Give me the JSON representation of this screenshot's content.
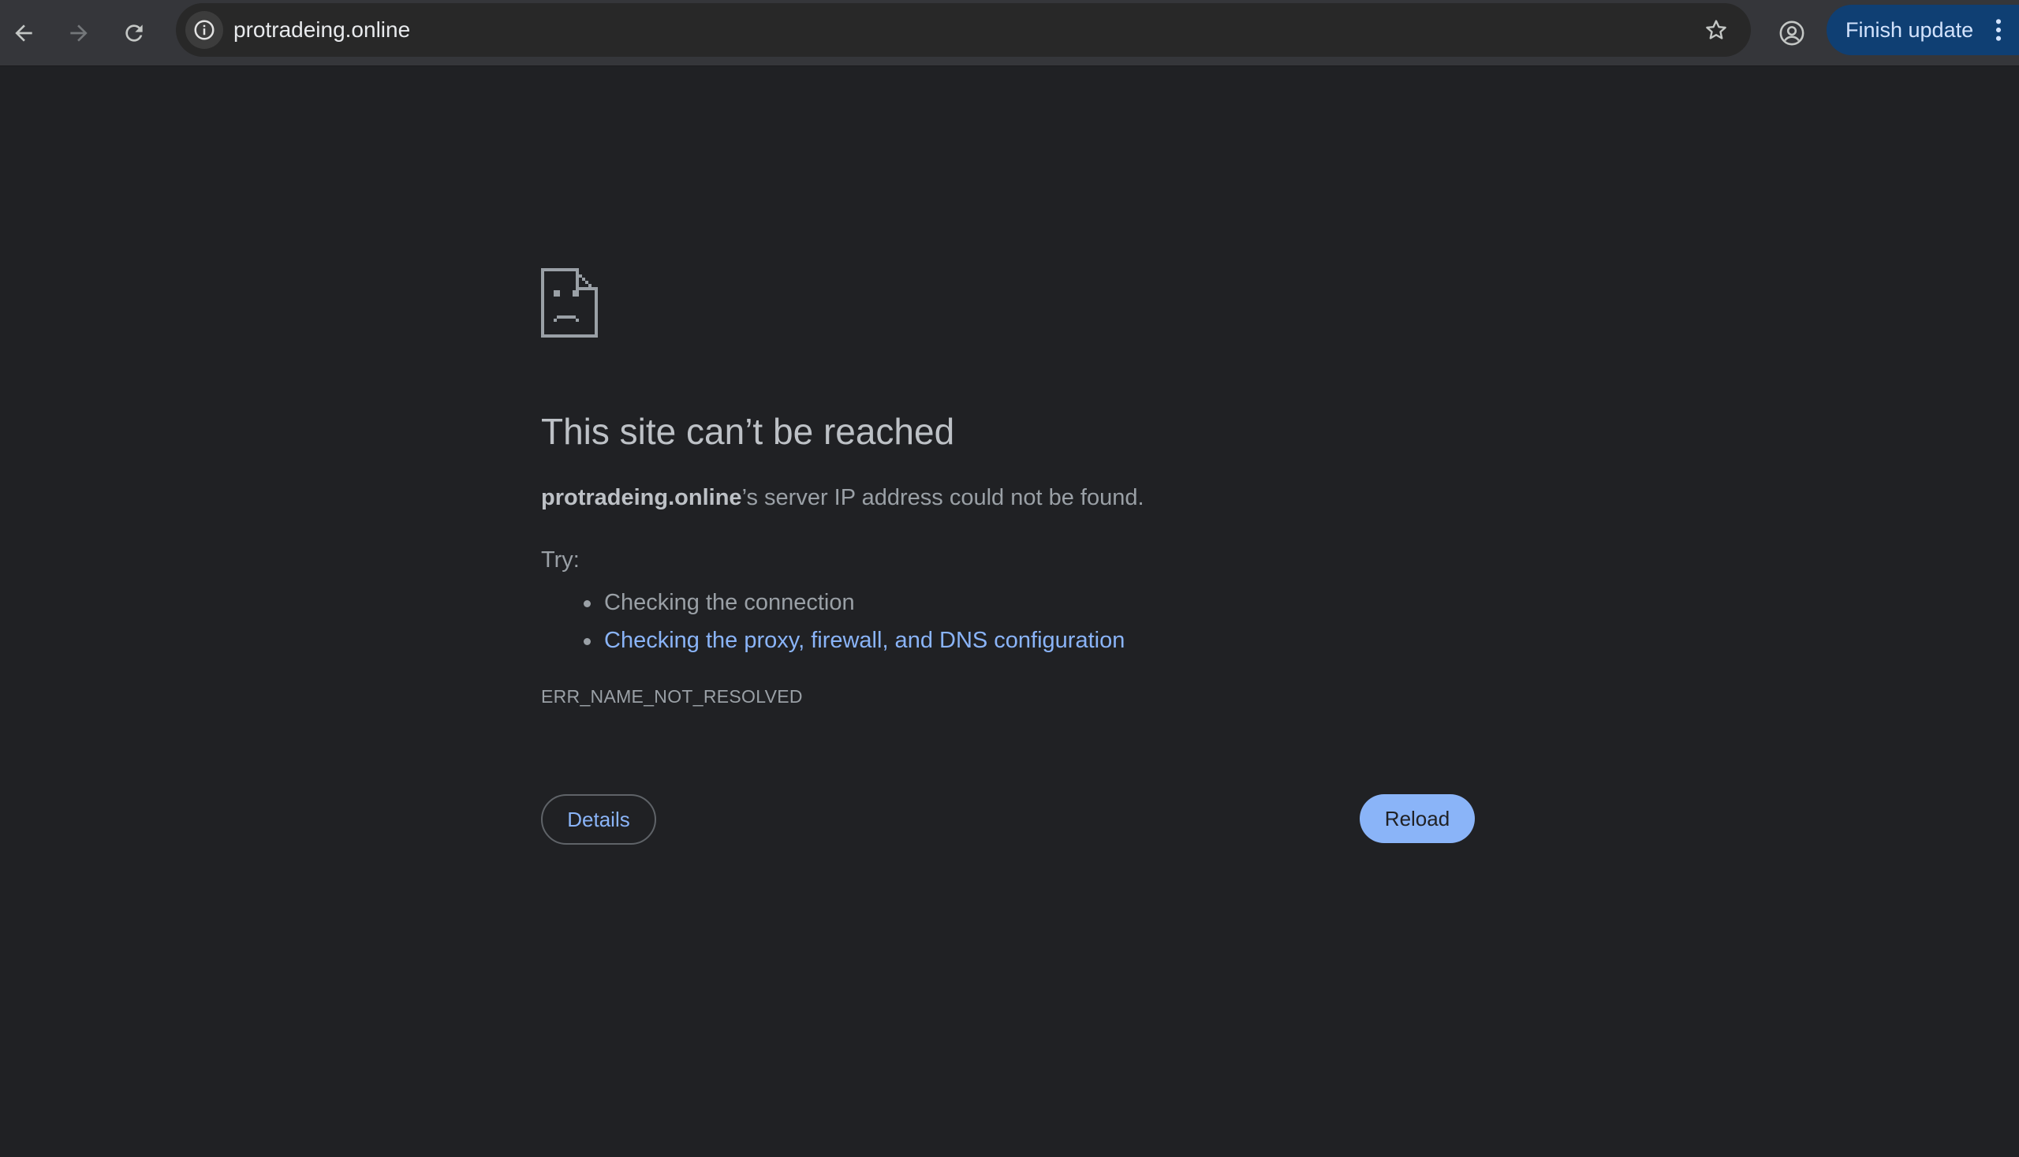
{
  "toolbar": {
    "back_icon": "arrow-back-icon",
    "forward_icon": "arrow-forward-icon",
    "reload_icon": "reload-icon",
    "url": "protradeing.online",
    "site_info_icon": "info-icon",
    "bookmark_icon": "star-icon",
    "profile_icon": "account-circle-icon",
    "finish_update_label": "Finish update",
    "menu_icon": "more-vert-icon"
  },
  "error_page": {
    "icon": "sad-page-icon",
    "title": "This site can’t be reached",
    "host": "protradeing.online",
    "summary_rest": "’s server IP address could not be found.",
    "try_label": "Try:",
    "suggestions": [
      "Checking the connection",
      "Checking the proxy, firewall, and DNS configuration"
    ],
    "error_code": "ERR_NAME_NOT_RESOLVED",
    "details_label": "Details",
    "reload_label": "Reload"
  },
  "colors": {
    "background": "#202124",
    "toolbar": "#35363a",
    "link": "#8ab4f8",
    "finish_update_bg": "#0f3f73"
  }
}
